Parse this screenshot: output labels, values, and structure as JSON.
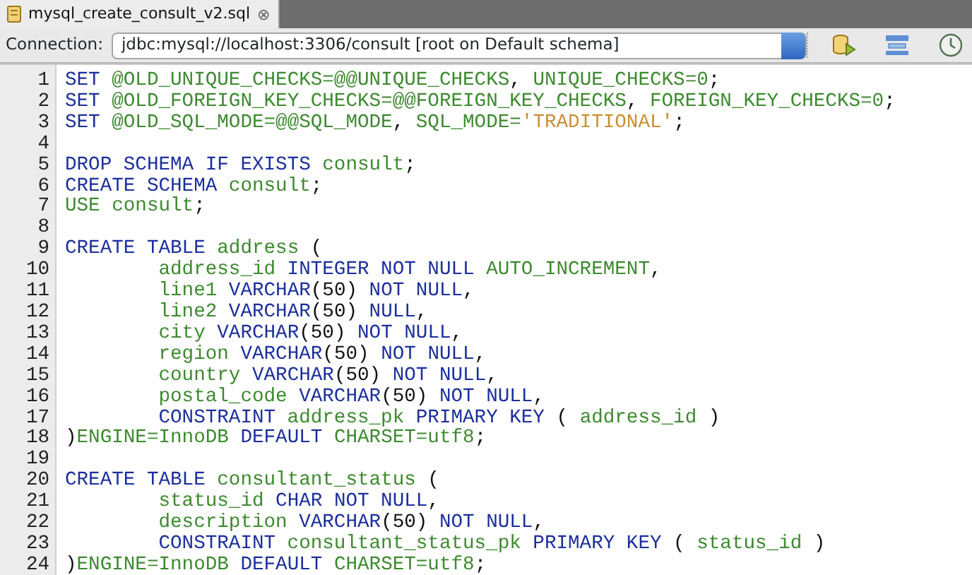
{
  "tab": {
    "title": "mysql_create_consult_v2.sql",
    "selected": true,
    "close": "⊗"
  },
  "connection": {
    "label": "Connection:",
    "value": "jdbc:mysql://localhost:3306/consult [root on Default schema]"
  },
  "editor": {
    "lines": [
      {
        "number": "1",
        "tokens": [
          {
            "kind": "kw",
            "text": "SET"
          },
          {
            "kind": "id",
            "text": " @OLD_UNIQUE_CHECKS=@@UNIQUE_CHECKS"
          },
          {
            "kind": "p",
            "text": ", "
          },
          {
            "kind": "id",
            "text": "UNIQUE_CHECKS=0"
          },
          {
            "kind": "p",
            "text": ";"
          }
        ]
      },
      {
        "number": "2",
        "tokens": [
          {
            "kind": "kw",
            "text": "SET"
          },
          {
            "kind": "id",
            "text": " @OLD_FOREIGN_KEY_CHECKS=@@FOREIGN_KEY_CHECKS"
          },
          {
            "kind": "p",
            "text": ", "
          },
          {
            "kind": "id",
            "text": "FOREIGN_KEY_CHECKS=0"
          },
          {
            "kind": "p",
            "text": ";"
          }
        ]
      },
      {
        "number": "3",
        "tokens": [
          {
            "kind": "kw",
            "text": "SET"
          },
          {
            "kind": "id",
            "text": " @OLD_SQL_MODE=@@SQL_MODE"
          },
          {
            "kind": "p",
            "text": ", "
          },
          {
            "kind": "id",
            "text": "SQL_MODE="
          },
          {
            "kind": "str",
            "text": "'TRADITIONAL'"
          },
          {
            "kind": "p",
            "text": ";"
          }
        ]
      },
      {
        "number": "4"
      },
      {
        "number": "5",
        "tokens": [
          {
            "kind": "kw",
            "text": "DROP SCHEMA IF EXISTS"
          },
          {
            "kind": "id",
            "text": " consult"
          },
          {
            "kind": "p",
            "text": ";"
          }
        ]
      },
      {
        "number": "6",
        "tokens": [
          {
            "kind": "kw",
            "text": "CREATE SCHEMA"
          },
          {
            "kind": "id",
            "text": " consult"
          },
          {
            "kind": "p",
            "text": ";"
          }
        ]
      },
      {
        "number": "7",
        "tokens": [
          {
            "kind": "id",
            "text": "USE consult"
          },
          {
            "kind": "p",
            "text": ";"
          }
        ]
      },
      {
        "number": "8"
      },
      {
        "number": "9",
        "tokens": [
          {
            "kind": "kw",
            "text": "CREATE TABLE"
          },
          {
            "kind": "id",
            "text": " address"
          },
          {
            "kind": "p",
            "text": " ("
          }
        ]
      },
      {
        "number": "10",
        "tokens": [
          {
            "kind": "id",
            "text": "        address_id"
          },
          {
            "kind": "kw",
            "text": " INTEGER NOT NULL"
          },
          {
            "kind": "id",
            "text": " AUTO_INCREMENT"
          },
          {
            "kind": "p",
            "text": ","
          }
        ]
      },
      {
        "number": "11",
        "tokens": [
          {
            "kind": "id",
            "text": "        line1"
          },
          {
            "kind": "kw",
            "text": " VARCHAR"
          },
          {
            "kind": "p",
            "text": "(50) "
          },
          {
            "kind": "kw",
            "text": "NOT NULL"
          },
          {
            "kind": "p",
            "text": ","
          }
        ]
      },
      {
        "number": "12",
        "tokens": [
          {
            "kind": "id",
            "text": "        line2"
          },
          {
            "kind": "kw",
            "text": " VARCHAR"
          },
          {
            "kind": "p",
            "text": "(50) "
          },
          {
            "kind": "kw",
            "text": "NULL"
          },
          {
            "kind": "p",
            "text": ","
          }
        ]
      },
      {
        "number": "13",
        "tokens": [
          {
            "kind": "id",
            "text": "        city"
          },
          {
            "kind": "kw",
            "text": " VARCHAR"
          },
          {
            "kind": "p",
            "text": "(50) "
          },
          {
            "kind": "kw",
            "text": "NOT NULL"
          },
          {
            "kind": "p",
            "text": ","
          }
        ]
      },
      {
        "number": "14",
        "tokens": [
          {
            "kind": "id",
            "text": "        region"
          },
          {
            "kind": "kw",
            "text": " VARCHAR"
          },
          {
            "kind": "p",
            "text": "(50) "
          },
          {
            "kind": "kw",
            "text": "NOT NULL"
          },
          {
            "kind": "p",
            "text": ","
          }
        ]
      },
      {
        "number": "15",
        "tokens": [
          {
            "kind": "id",
            "text": "        country"
          },
          {
            "kind": "kw",
            "text": " VARCHAR"
          },
          {
            "kind": "p",
            "text": "(50) "
          },
          {
            "kind": "kw",
            "text": "NOT NULL"
          },
          {
            "kind": "p",
            "text": ","
          }
        ]
      },
      {
        "number": "16",
        "tokens": [
          {
            "kind": "id",
            "text": "        postal_code"
          },
          {
            "kind": "kw",
            "text": " VARCHAR"
          },
          {
            "kind": "p",
            "text": "(50) "
          },
          {
            "kind": "kw",
            "text": "NOT NULL"
          },
          {
            "kind": "p",
            "text": ","
          }
        ]
      },
      {
        "number": "17",
        "tokens": [
          {
            "kind": "kw",
            "text": "        CONSTRAINT"
          },
          {
            "kind": "id",
            "text": " address_pk"
          },
          {
            "kind": "kw",
            "text": " PRIMARY KEY"
          },
          {
            "kind": "p",
            "text": " ( "
          },
          {
            "kind": "id",
            "text": "address_id"
          },
          {
            "kind": "p",
            "text": " )"
          }
        ]
      },
      {
        "number": "18",
        "tokens": [
          {
            "kind": "p",
            "text": ")"
          },
          {
            "kind": "id",
            "text": "ENGINE=InnoDB"
          },
          {
            "kind": "kw",
            "text": " DEFAULT"
          },
          {
            "kind": "id",
            "text": " CHARSET=utf8"
          },
          {
            "kind": "p",
            "text": ";"
          }
        ]
      },
      {
        "number": "19"
      },
      {
        "number": "20",
        "tokens": [
          {
            "kind": "kw",
            "text": "CREATE TABLE"
          },
          {
            "kind": "id",
            "text": " consultant_status"
          },
          {
            "kind": "p",
            "text": " ("
          }
        ]
      },
      {
        "number": "21",
        "tokens": [
          {
            "kind": "id",
            "text": "        status_id"
          },
          {
            "kind": "kw",
            "text": " CHAR NOT NULL"
          },
          {
            "kind": "p",
            "text": ","
          }
        ]
      },
      {
        "number": "22",
        "tokens": [
          {
            "kind": "id",
            "text": "        description"
          },
          {
            "kind": "kw",
            "text": " VARCHAR"
          },
          {
            "kind": "p",
            "text": "(50) "
          },
          {
            "kind": "kw",
            "text": "NOT NULL"
          },
          {
            "kind": "p",
            "text": ","
          }
        ]
      },
      {
        "number": "23",
        "tokens": [
          {
            "kind": "kw",
            "text": "        CONSTRAINT"
          },
          {
            "kind": "id",
            "text": " consultant_status_pk"
          },
          {
            "kind": "kw",
            "text": " PRIMARY KEY"
          },
          {
            "kind": "p",
            "text": " ( "
          },
          {
            "kind": "id",
            "text": "status_id"
          },
          {
            "kind": "p",
            "text": " )"
          }
        ]
      },
      {
        "number": "24",
        "tokens": [
          {
            "kind": "p",
            "text": ")"
          },
          {
            "kind": "id",
            "text": "ENGINE=InnoDB"
          },
          {
            "kind": "kw",
            "text": " DEFAULT"
          },
          {
            "kind": "id",
            "text": " CHARSET=utf8"
          },
          {
            "kind": "p",
            "text": ";"
          }
        ]
      }
    ]
  }
}
